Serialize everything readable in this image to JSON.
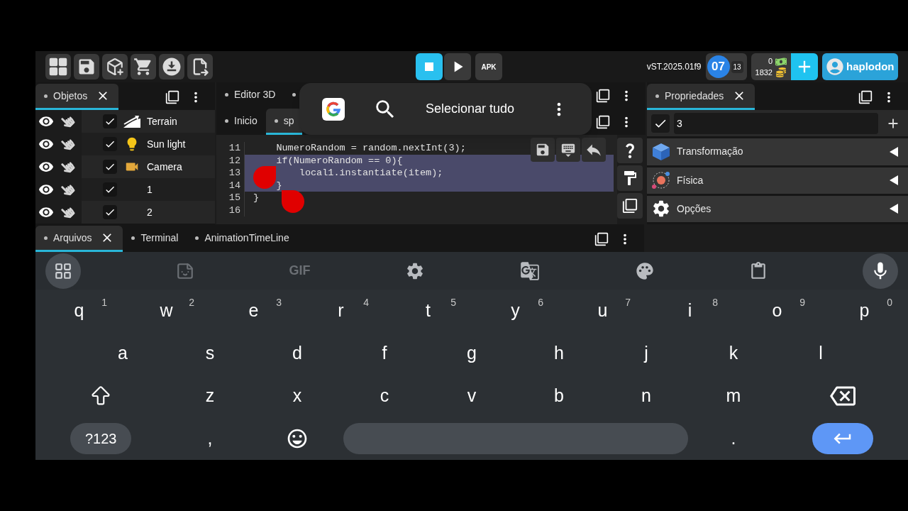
{
  "toolbar": {
    "version": "vST.2025.01f9",
    "level": "07",
    "level_sub": "13",
    "balances": [
      "0",
      "1832"
    ],
    "apk_label": "APK",
    "user": "haplodon"
  },
  "objects_panel": {
    "tabs": [
      {
        "label": "Objetos",
        "selected": true
      }
    ],
    "items": [
      {
        "name": "Terrain",
        "kind": "terrain",
        "checked": true
      },
      {
        "name": "Sun light",
        "kind": "light",
        "checked": true
      },
      {
        "name": "Camera",
        "kind": "camera",
        "checked": true
      },
      {
        "name": "1",
        "kind": "object",
        "checked": true
      },
      {
        "name": "2",
        "kind": "object",
        "checked": true
      }
    ]
  },
  "editor_panel": {
    "tab_rows": [
      [
        {
          "label": "Editor 3D",
          "selected": false
        },
        {
          "selected": false
        }
      ],
      [
        {
          "label": "Inicio",
          "selected": false
        },
        {
          "label": "sp",
          "selected": true
        }
      ]
    ],
    "code_lines": [
      {
        "number": "11",
        "text": "    NumeroRandom = random.nextInt(3);",
        "selected": false
      },
      {
        "number": "12",
        "text": "    if(NumeroRandom == 0){",
        "selected": true
      },
      {
        "number": "13",
        "text": "        local1.instantiate(item);",
        "selected": true
      },
      {
        "number": "14",
        "text": "    }",
        "selected": true
      },
      {
        "number": "15",
        "text": "}",
        "selected": false
      },
      {
        "number": "16",
        "selected": false
      }
    ]
  },
  "popup": {
    "action": "Selecionar tudo"
  },
  "properties_panel": {
    "tabs": [
      {
        "label": "Propriedades",
        "selected": true
      }
    ],
    "enabled": true,
    "name": "3",
    "sections": [
      {
        "title": "Transformação",
        "kind": "transform",
        "expanded": false
      },
      {
        "title": "Física",
        "kind": "physics",
        "expanded": false
      },
      {
        "title": "Opções",
        "kind": "options",
        "expanded": false
      }
    ]
  },
  "bottom_panel": {
    "tabs": [
      {
        "label": "Arquivos",
        "selected": true
      },
      {
        "label": "Terminal",
        "selected": false
      },
      {
        "label": "AnimationTimeLine",
        "selected": false
      }
    ]
  },
  "keyboard": {
    "gif_label": "GIF",
    "rows": [
      {
        "keys": [
          {
            "kind": "char",
            "label": "q",
            "hint": "1"
          },
          {
            "kind": "char",
            "label": "w",
            "hint": "2"
          },
          {
            "kind": "char",
            "label": "e",
            "hint": "3"
          },
          {
            "kind": "char",
            "label": "r",
            "hint": "4"
          },
          {
            "kind": "char",
            "label": "t",
            "hint": "5"
          },
          {
            "kind": "char",
            "label": "y",
            "hint": "6"
          },
          {
            "kind": "char",
            "label": "u",
            "hint": "7"
          },
          {
            "kind": "char",
            "label": "i",
            "hint": "8"
          },
          {
            "kind": "char",
            "label": "o",
            "hint": "9"
          },
          {
            "kind": "char",
            "label": "p",
            "hint": "0"
          }
        ]
      },
      {
        "keys": [
          {
            "kind": "char",
            "label": "a"
          },
          {
            "kind": "char",
            "label": "s"
          },
          {
            "kind": "char",
            "label": "d"
          },
          {
            "kind": "char",
            "label": "f"
          },
          {
            "kind": "char",
            "label": "g"
          },
          {
            "kind": "char",
            "label": "h"
          },
          {
            "kind": "char",
            "label": "j"
          },
          {
            "kind": "char",
            "label": "k"
          },
          {
            "kind": "char",
            "label": "l"
          }
        ]
      },
      {
        "keys": [
          {
            "kind": "shift"
          },
          {
            "kind": "char",
            "label": "z"
          },
          {
            "kind": "char",
            "label": "x"
          },
          {
            "kind": "char",
            "label": "c"
          },
          {
            "kind": "char",
            "label": "v"
          },
          {
            "kind": "char",
            "label": "b"
          },
          {
            "kind": "char",
            "label": "n"
          },
          {
            "kind": "char",
            "label": "m"
          },
          {
            "kind": "backspace"
          }
        ]
      },
      {
        "keys": [
          {
            "kind": "mode",
            "label": "?123"
          },
          {
            "kind": "char",
            "label": ","
          },
          {
            "kind": "emoji"
          },
          {
            "kind": "space"
          },
          {
            "kind": "char",
            "label": "."
          },
          {
            "kind": "enter"
          }
        ]
      }
    ]
  }
}
